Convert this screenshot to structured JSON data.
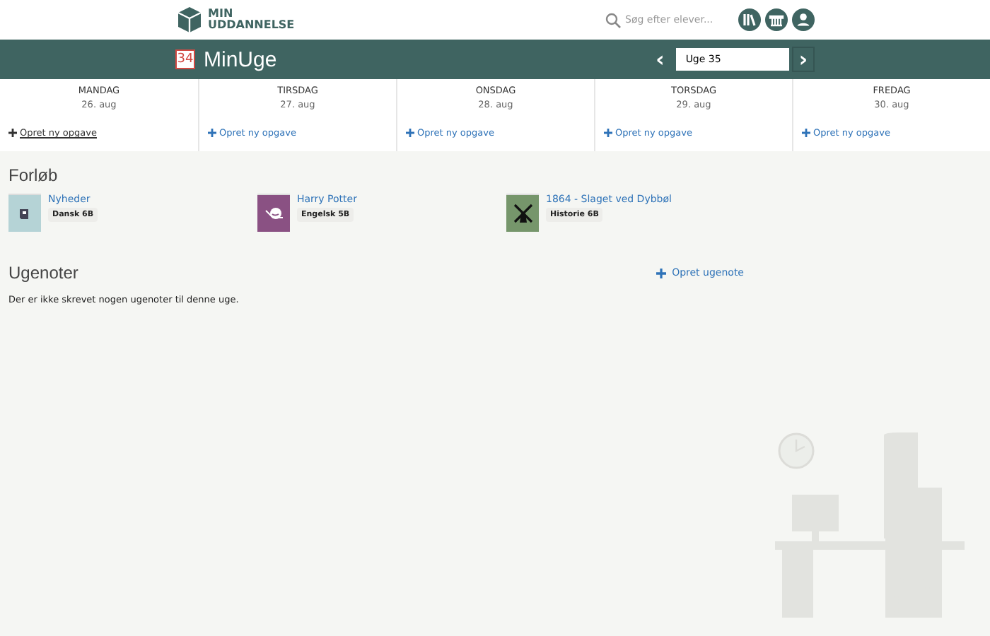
{
  "header": {
    "logo_line_1": "MIN",
    "logo_line_2": "UDDANNELSE",
    "search": {
      "placeholder": "Søg efter elever..."
    }
  },
  "title_bar": {
    "week_badge": "34",
    "title": "MinUge",
    "prev": "‹",
    "week_field": {
      "value": "Uge 35"
    },
    "next": "›"
  },
  "days": [
    {
      "name": "MANDAG",
      "date": "26. aug",
      "add_task": "Opret ny opgave",
      "hovered": true
    },
    {
      "name": "TIRSDAG",
      "date": "27. aug",
      "add_task": "Opret ny opgave",
      "hovered": false
    },
    {
      "name": "ONSDAG",
      "date": "28. aug",
      "add_task": "Opret ny opgave",
      "hovered": false
    },
    {
      "name": "TORSDAG",
      "date": "29. aug",
      "add_task": "Opret ny opgave",
      "hovered": false
    },
    {
      "name": "FREDAG",
      "date": "30. aug",
      "add_task": "Opret ny opgave",
      "hovered": false
    }
  ],
  "courses": {
    "heading": "Forløb",
    "items": [
      {
        "title": "Nyheder",
        "tag": "Dansk 6B",
        "kind": "newspaper",
        "color": "#b5d3d6"
      },
      {
        "title": "Harry Potter",
        "tag": "Engelsk 5B",
        "kind": "hat",
        "color": "#8a5183"
      },
      {
        "title": "1864 - Slaget ved Dybbøl",
        "tag": "Historie 6B",
        "kind": "windmill",
        "color": "#76966b"
      }
    ]
  },
  "notes": {
    "heading": "Ugenoter",
    "add_note": "Opret ugenote",
    "empty_text": "Der er ikke skrevet nogen ugenoter til denne uge."
  }
}
